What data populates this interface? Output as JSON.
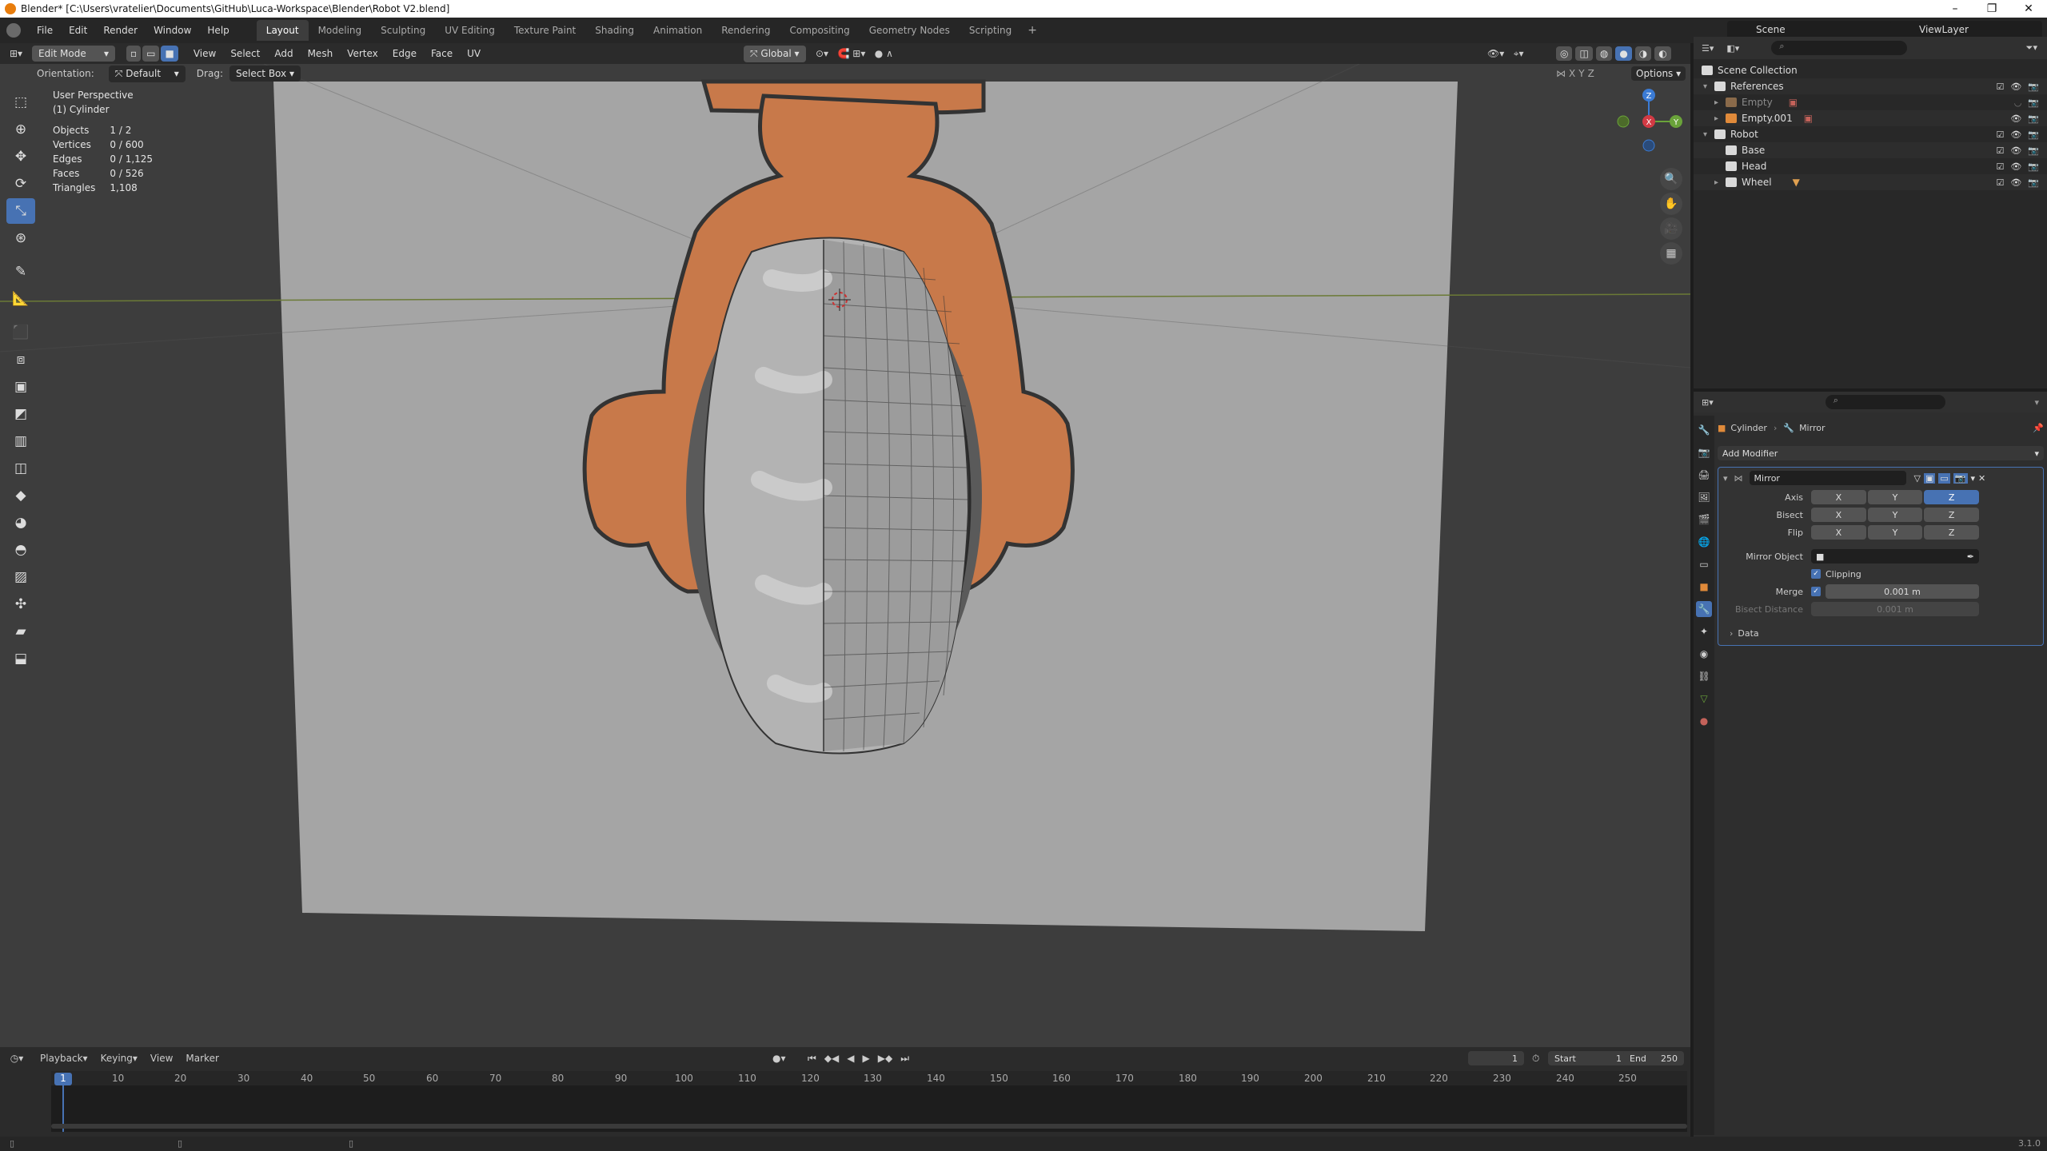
{
  "window": {
    "title": "Blender* [C:\\Users\\vratelier\\Documents\\GitHub\\Luca-Workspace\\Blender\\Robot V2.blend]",
    "controls": [
      "–",
      "❐",
      "✕"
    ]
  },
  "menu": {
    "items": [
      "File",
      "Edit",
      "Render",
      "Window",
      "Help"
    ]
  },
  "workspaces": {
    "active": "Layout",
    "items": [
      "Layout",
      "Modeling",
      "Sculpting",
      "UV Editing",
      "Texture Paint",
      "Shading",
      "Animation",
      "Rendering",
      "Compositing",
      "Geometry Nodes",
      "Scripting"
    ]
  },
  "scene": {
    "name": "Scene",
    "view_layer": "ViewLayer"
  },
  "viewport_header": {
    "mode": "Edit Mode",
    "menus": [
      "View",
      "Select",
      "Add",
      "Mesh",
      "Vertex",
      "Edge",
      "Face",
      "UV"
    ],
    "transform": "Global",
    "options": "Options",
    "axes": [
      "X",
      "Y",
      "Z"
    ]
  },
  "tool_settings": {
    "orientation_label": "Orientation:",
    "orientation": "Default",
    "drag_label": "Drag:",
    "drag": "Select Box"
  },
  "overlay": {
    "view": "User Perspective",
    "object": "(1) Cylinder",
    "stats": [
      {
        "label": "Objects",
        "value": "1 / 2"
      },
      {
        "label": "Vertices",
        "value": "0 / 600"
      },
      {
        "label": "Edges",
        "value": "0 / 1,125"
      },
      {
        "label": "Faces",
        "value": "0 / 526"
      },
      {
        "label": "Triangles",
        "value": "1,108"
      }
    ]
  },
  "gizmo": {
    "axes": [
      "Z",
      "Y",
      "X"
    ]
  },
  "timeline": {
    "menus": [
      "Playback",
      "Keying",
      "View",
      "Marker"
    ],
    "current_frame": "1",
    "start_label": "Start",
    "start": "1",
    "end_label": "End",
    "end": "250",
    "ticks": [
      "1",
      "10",
      "20",
      "30",
      "40",
      "50",
      "60",
      "70",
      "80",
      "90",
      "100",
      "110",
      "120",
      "130",
      "140",
      "150",
      "160",
      "170",
      "180",
      "190",
      "200",
      "210",
      "220",
      "230",
      "240",
      "250"
    ]
  },
  "outliner": {
    "rows": [
      {
        "label": "Scene Collection",
        "indent": 0,
        "twisty": ""
      },
      {
        "label": "References",
        "indent": 1,
        "twisty": "▾"
      },
      {
        "label": "Empty",
        "indent": 2,
        "twisty": "▸",
        "dim": true
      },
      {
        "label": "Empty.001",
        "indent": 2,
        "twisty": "▸",
        "dim": false
      },
      {
        "label": "Robot",
        "indent": 1,
        "twisty": "▾"
      },
      {
        "label": "Base",
        "indent": 2,
        "twisty": ""
      },
      {
        "label": "Head",
        "indent": 2,
        "twisty": ""
      },
      {
        "label": "Wheel",
        "indent": 2,
        "twisty": "▸"
      }
    ]
  },
  "properties": {
    "breadcrumb": {
      "object": "Cylinder",
      "modifier": "Mirror"
    },
    "add_modifier": "Add Modifier",
    "modifier": {
      "name": "Mirror",
      "axis_label": "Axis",
      "bisect_label": "Bisect",
      "flip_label": "Flip",
      "axes": [
        "X",
        "Y",
        "Z"
      ],
      "mirror_object_label": "Mirror Object",
      "clipping_label": "Clipping",
      "merge_label": "Merge",
      "merge_value": "0.001 m",
      "bisect_distance_label": "Bisect Distance",
      "bisect_distance_value": "0.001 m",
      "data_label": "Data"
    }
  },
  "status": {
    "version": "3.1.0"
  }
}
